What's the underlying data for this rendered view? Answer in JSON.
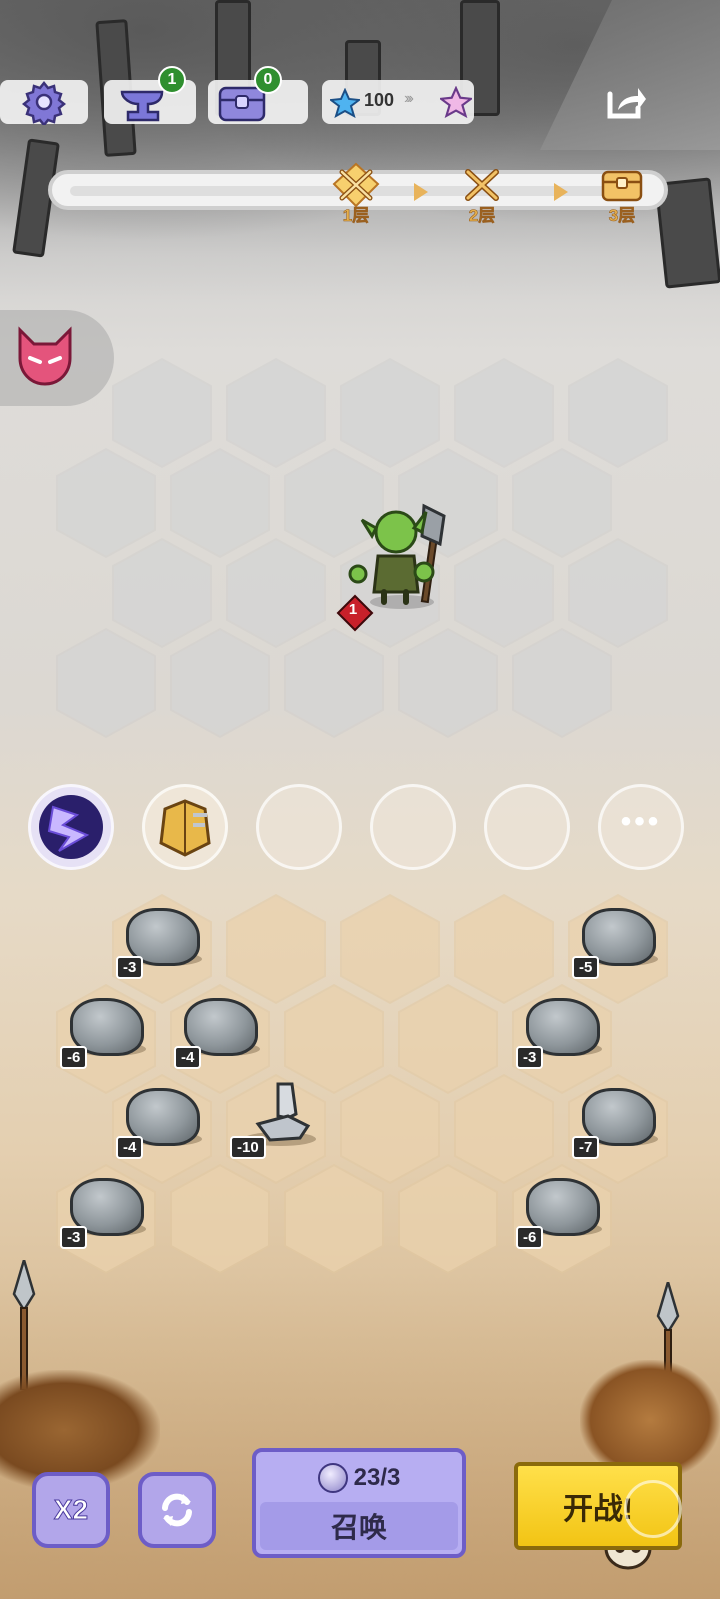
{
  "colors": {
    "summon_button": "#b7aef2",
    "start_button": "#f7d21c",
    "progress_accent": "#e6b14d",
    "player_hex": "#ecd6b2",
    "enemy_hex": "#d7d7d7"
  },
  "topbar": {
    "settings_icon": "gear-icon",
    "anvil_count": "1",
    "chest_count": "0",
    "star_value": "100",
    "share_icon": "share-icon"
  },
  "progress": {
    "stages": [
      {
        "label": "1层",
        "icon": "crossed-swords-icon",
        "current": true
      },
      {
        "label": "2层",
        "icon": "crossed-swords-icon",
        "current": false
      },
      {
        "label": "3层",
        "icon": "treasure-chest-icon",
        "current": false
      }
    ]
  },
  "enemy": {
    "unit_name": "goblin",
    "level": "1"
  },
  "equipment_slots": [
    "lightning-artifact",
    "golden-armor-artifact",
    "",
    "",
    ""
  ],
  "obstacles": [
    {
      "type": "rock",
      "cost": "-3"
    },
    {
      "type": "rock",
      "cost": "-5"
    },
    {
      "type": "rock",
      "cost": "-6"
    },
    {
      "type": "rock",
      "cost": "-4"
    },
    {
      "type": "rock",
      "cost": "-3"
    },
    {
      "type": "rock",
      "cost": "-4"
    },
    {
      "type": "statue",
      "cost": "-10"
    },
    {
      "type": "rock",
      "cost": "-7"
    },
    {
      "type": "rock",
      "cost": "-3"
    },
    {
      "type": "rock",
      "cost": "-6"
    }
  ],
  "bottom": {
    "speed_label": "X2",
    "summon_count": "23/3",
    "summon_label": "召唤",
    "start_label": "开战!"
  }
}
